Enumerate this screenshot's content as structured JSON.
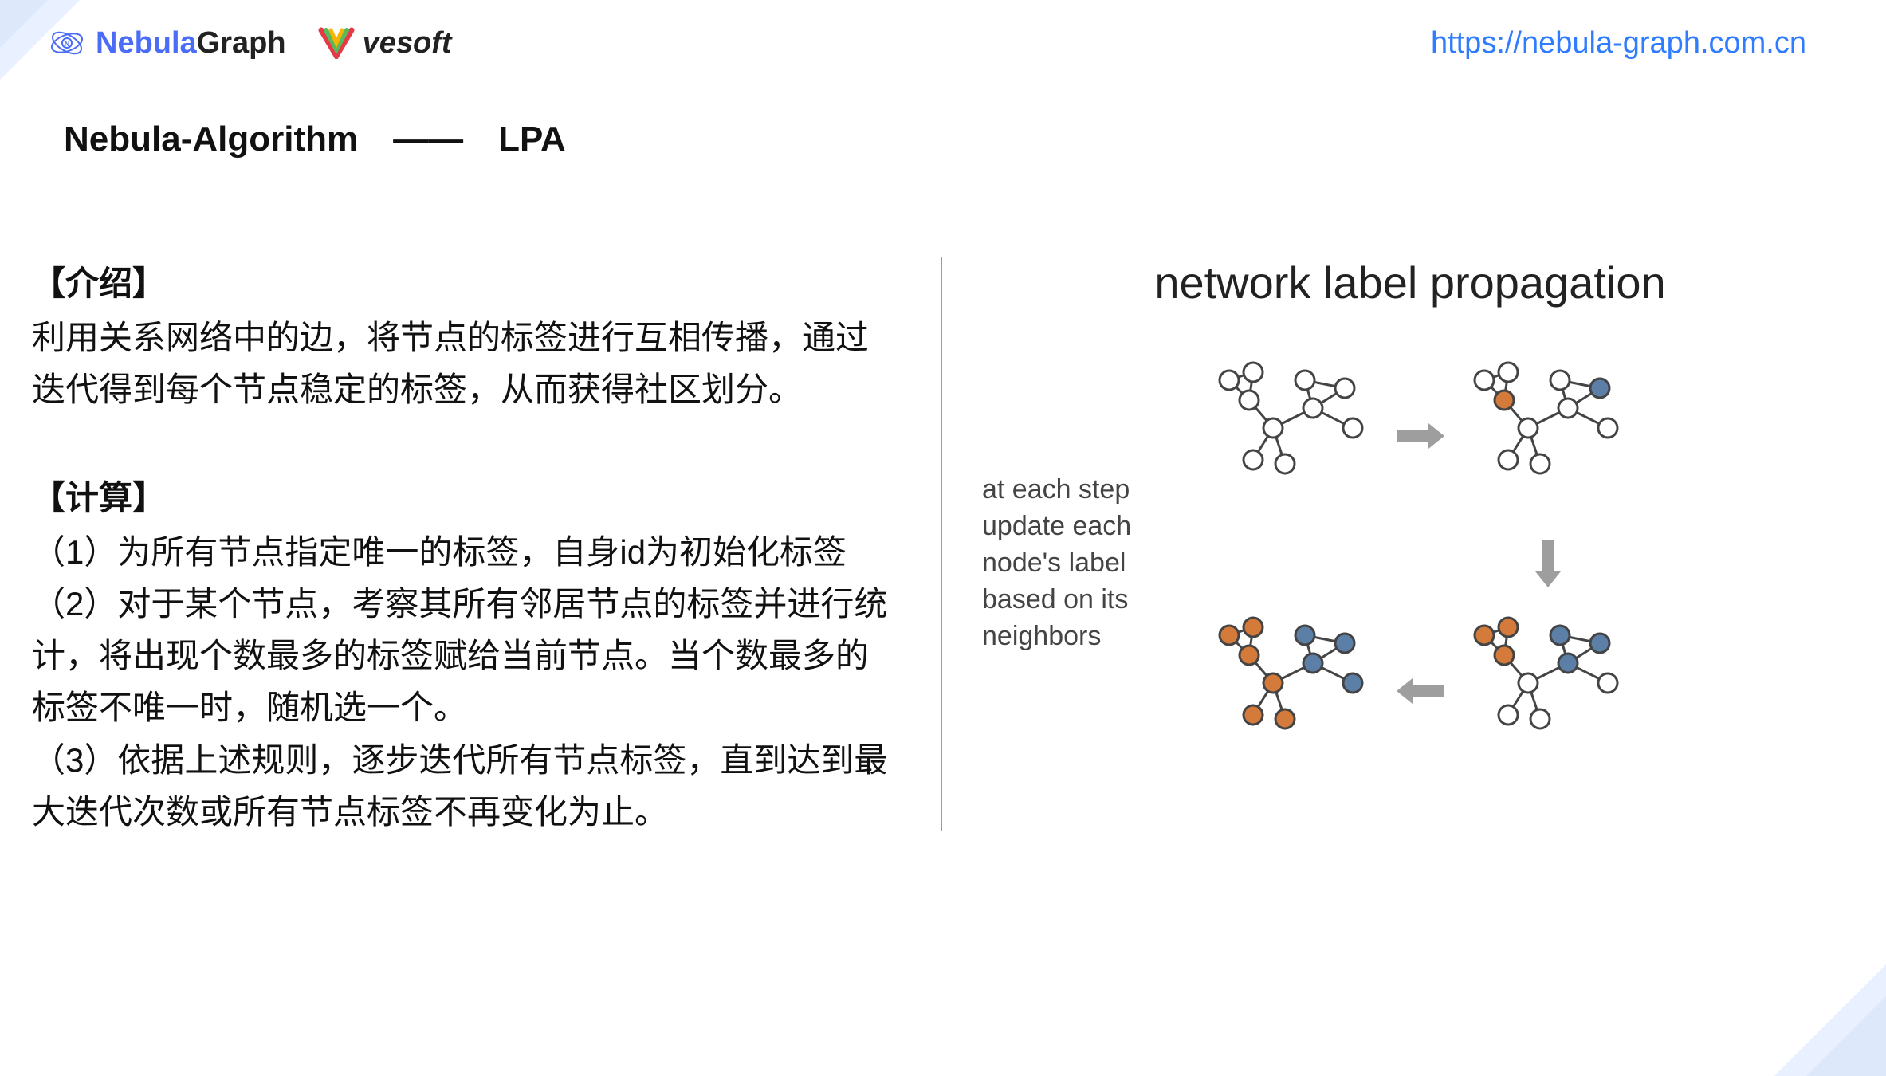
{
  "header": {
    "nebula_logo_part1": "Nebula",
    "nebula_logo_part2": "Graph",
    "vesoft_logo": "vesoft",
    "url": "https://nebula-graph.com.cn"
  },
  "title": "Nebula-Algorithm　——　LPA",
  "left": {
    "intro_heading": "【介绍】",
    "intro_body": "利用关系网络中的边，将节点的标签进行互相传播，通过迭代得到每个节点稳定的标签，从而获得社区划分。",
    "calc_heading": "【计算】",
    "calc_step1": "（1）为所有节点指定唯一的标签，自身id为初始化标签",
    "calc_step2": "（2）对于某个节点，考察其所有邻居节点的标签并进行统计，将出现个数最多的标签赋给当前节点。当个数最多的标签不唯一时，随机选一个。",
    "calc_step3": "（3）依据上述规则，逐步迭代所有节点标签，直到达到最大迭代次数或所有节点标签不再变化为止。"
  },
  "right": {
    "diagram_title": "network label propagation",
    "caption_l1": "at each step",
    "caption_l2": "update each",
    "caption_l3": "node's label",
    "caption_l4": "based on its",
    "caption_l5": "neighbors"
  },
  "colors": {
    "white": "#FFFFFF",
    "orange": "#D47A3A",
    "blue": "#5C7FA8",
    "arrow": "#9E9E9E",
    "stroke": "#444444"
  }
}
